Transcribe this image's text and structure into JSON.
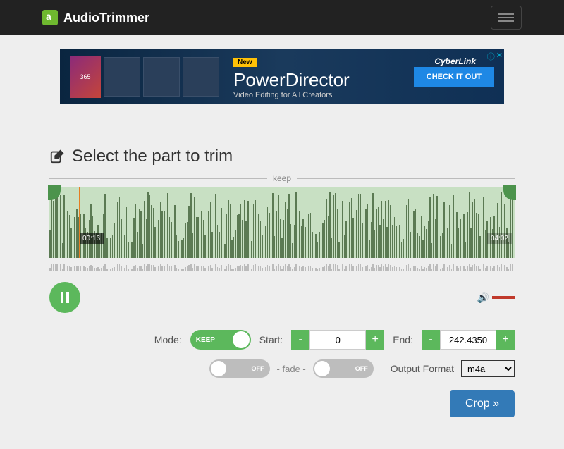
{
  "brand": "AudioTrimmer",
  "ad": {
    "new_badge": "New",
    "title": "PowerDirector",
    "subtitle": "Video Editing for All Creators",
    "cta": "CHECK IT OUT",
    "vendor": "CyberLink",
    "pkg": "365"
  },
  "section": {
    "title": "Select the part to trim",
    "keep_label": "keep"
  },
  "wave": {
    "playhead_time": "00:16",
    "end_time": "04:02"
  },
  "controls": {
    "mode_label": "Mode:",
    "mode_value": "KEEP",
    "start_label": "Start:",
    "start_value": "0",
    "end_label": "End:",
    "end_value": "242.4350",
    "fade_label": "- fade -",
    "fade_off": "OFF",
    "format_label": "Output Format",
    "format_value": "m4a",
    "crop": "Crop »",
    "minus": "-",
    "plus": "+"
  }
}
